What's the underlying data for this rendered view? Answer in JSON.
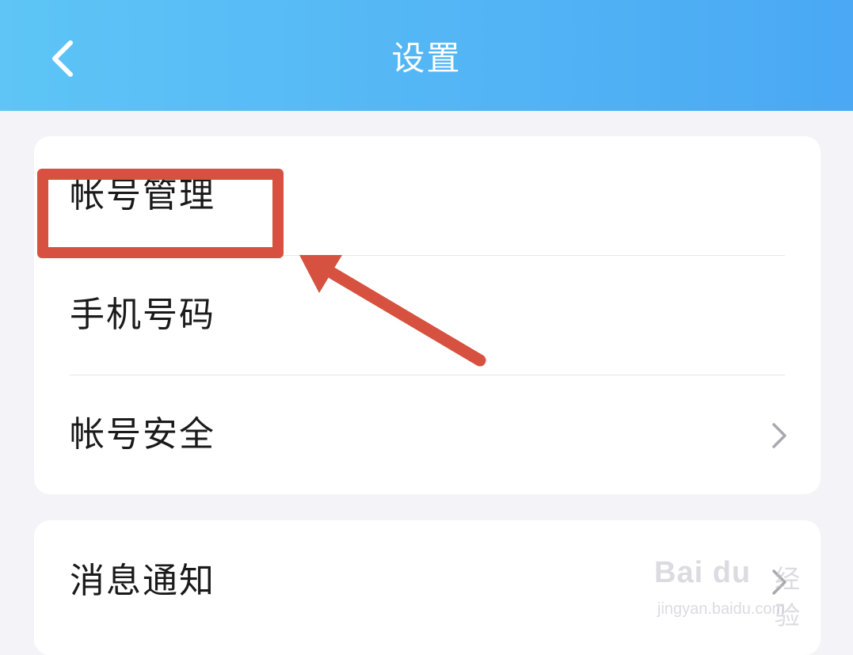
{
  "header": {
    "title": "设置",
    "back_icon": "chevron-left-icon",
    "background_colors": [
      "#5ec5f6",
      "#4aa8f4"
    ]
  },
  "sections": [
    {
      "items": [
        {
          "label": "帐号管理",
          "has_chevron": false
        },
        {
          "label": "手机号码",
          "has_chevron": false
        },
        {
          "label": "帐号安全",
          "has_chevron": true,
          "chevron_icon": "chevron-right-icon"
        }
      ]
    },
    {
      "items": [
        {
          "label": "消息通知",
          "has_chevron": true,
          "chevron_icon": "chevron-right-icon"
        }
      ]
    }
  ],
  "annotation": {
    "highlight_color": "#d6513f",
    "highlighted_item": "帐号管理"
  },
  "watermark": {
    "brand": "Bai du",
    "sub": "经验",
    "url": "jingyan.baidu.com"
  }
}
